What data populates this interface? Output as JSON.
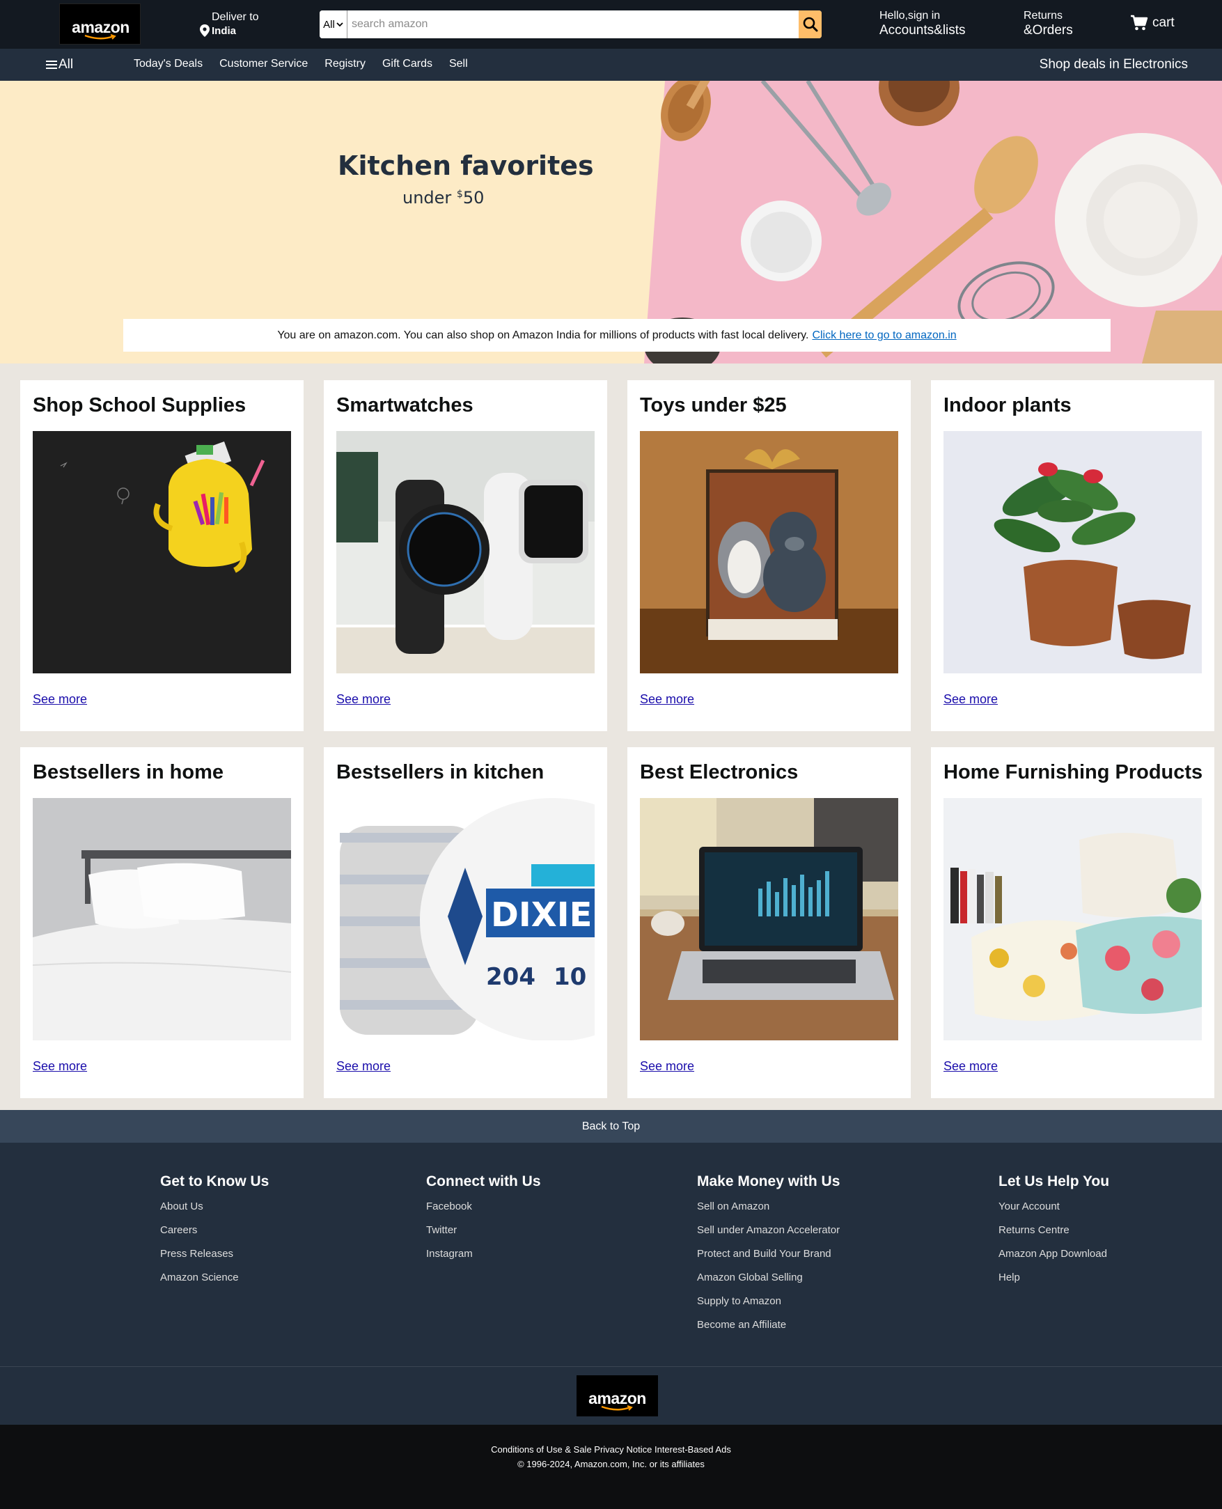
{
  "header": {
    "logo_text": "amazon",
    "deliver_label": "Deliver to",
    "deliver_location": "India",
    "search_category": "All",
    "search_placeholder": "search amazon",
    "account_greeting": "Hello,sign in",
    "account_label": "Accounts&lists",
    "returns_label": "Returns",
    "orders_label": "&Orders",
    "cart_label": "cart",
    "search_button_color": "#febd69"
  },
  "nav": {
    "all_label": "All",
    "links": [
      "Today's Deals",
      "Customer Service",
      "Registry",
      "Gift Cards",
      "Sell"
    ],
    "right_link": "Shop deals in Electronics"
  },
  "hero": {
    "title": "Kitchen favorites",
    "subtitle_prefix": "under ",
    "subtitle_currency": "$",
    "subtitle_amount": "50",
    "notice_text": "You are on amazon.com. You can also shop on Amazon India for millions of products with fast local delivery.",
    "notice_link": "Click here to go to amazon.in"
  },
  "cards": [
    {
      "title": "Shop School Supplies",
      "link": "See more",
      "image": "yellow-backpack-on-chalkboard"
    },
    {
      "title": "Smartwatches",
      "link": "See more",
      "image": "smartwatches"
    },
    {
      "title": "Toys under $25",
      "link": "See more",
      "image": "plush-toys-in-gift-box"
    },
    {
      "title": "Indoor plants",
      "link": "See more",
      "image": "potted-plant"
    },
    {
      "title": "Bestsellers in home",
      "link": "See more",
      "image": "white-bed"
    },
    {
      "title": "Bestsellers in kitchen",
      "link": "See more",
      "image": "paper-plates"
    },
    {
      "title": "Best Electronics",
      "link": "See more",
      "image": "laptop"
    },
    {
      "title": "Home Furnishing Products",
      "link": "See more",
      "image": "cushions"
    }
  ],
  "footer": {
    "back_to_top": "Back to Top",
    "columns": [
      {
        "title": "Get to Know Us",
        "items": [
          "About Us",
          "Careers",
          "Press Releases",
          "Amazon Science"
        ]
      },
      {
        "title": "Connect with Us",
        "items": [
          "Facebook",
          "Twitter",
          "Instagram"
        ]
      },
      {
        "title": "Make Money with Us",
        "items": [
          "Sell on Amazon",
          "Sell under Amazon Accelerator",
          "Protect and Build Your Brand",
          "Amazon Global Selling",
          "Supply to Amazon",
          "Become an Affiliate"
        ]
      },
      {
        "title": "Let Us Help You",
        "items": [
          "Your Account",
          "Returns Centre",
          "Amazon App Download",
          "Help"
        ]
      }
    ],
    "logo_text": "amazon",
    "bottom_links": "Conditions of Use & Sale Privacy Notice Interest-Based Ads",
    "copyright": "© 1996-2024, Amazon.com, Inc. or its affiliates"
  },
  "colors": {
    "header_bg": "#131921",
    "nav_bg": "#232f3e",
    "hero_bg": "#fdebc6",
    "hero_pink": "#f4b8c8",
    "link_blue": "#1a0dab",
    "back_to_top_bg": "#37475a",
    "footer_bg": "#232f3e",
    "bottom_bg": "#0d0e10"
  }
}
